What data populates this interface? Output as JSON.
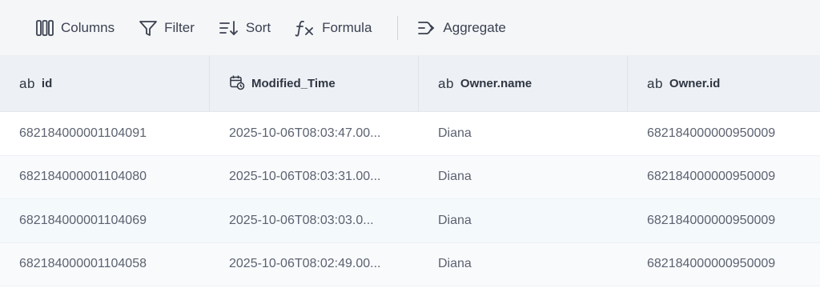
{
  "toolbar": {
    "columns_label": "Columns",
    "filter_label": "Filter",
    "sort_label": "Sort",
    "formula_label": "Formula",
    "aggregate_label": "Aggregate"
  },
  "grid": {
    "headers": [
      {
        "type_icon": "ab",
        "label": "id"
      },
      {
        "type_icon": "calendar-clock-icon",
        "label": "Modified_Time"
      },
      {
        "type_icon": "ab",
        "label": "Owner.name"
      },
      {
        "type_icon": "ab",
        "label": "Owner.id"
      }
    ],
    "rows": [
      {
        "id": "682184000001104091",
        "modified_time": "2025-10-06T08:03:47.00...",
        "owner_name": "Diana",
        "owner_id": "682184000000950009"
      },
      {
        "id": "682184000001104080",
        "modified_time": "2025-10-06T08:03:31.00...",
        "owner_name": "Diana",
        "owner_id": "682184000000950009"
      },
      {
        "id": "682184000001104069",
        "modified_time": "2025-10-06T08:03:03.0...",
        "owner_name": "Diana",
        "owner_id": "682184000000950009"
      },
      {
        "id": "682184000001104058",
        "modified_time": "2025-10-06T08:02:49.00...",
        "owner_name": "Diana",
        "owner_id": "682184000000950009"
      }
    ]
  }
}
